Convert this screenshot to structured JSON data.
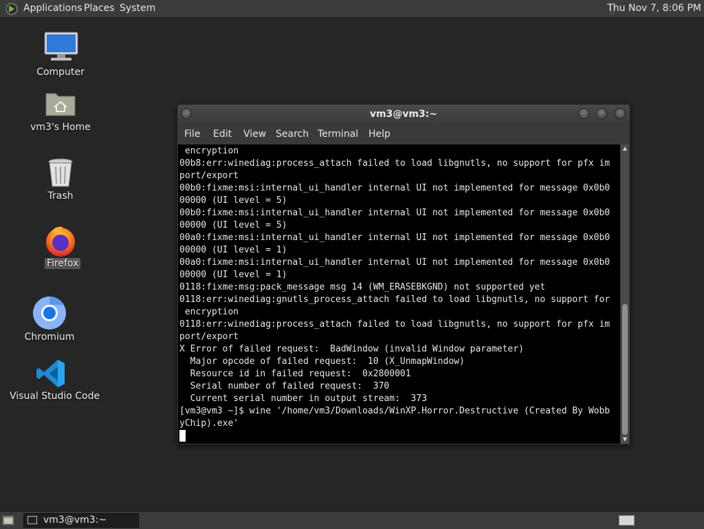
{
  "top_panel": {
    "menus": [
      "Applications",
      "Places",
      "System"
    ],
    "clock": "Thu Nov 7,  8:06 PM"
  },
  "desktop_icons": [
    {
      "label": "Computer"
    },
    {
      "label": "vm3's Home"
    },
    {
      "label": "Trash"
    },
    {
      "label": "Firefox"
    },
    {
      "label": "Chromium"
    },
    {
      "label": "Visual Studio Code"
    }
  ],
  "terminal": {
    "title": "vm3@vm3:~",
    "menus": [
      "File",
      "Edit",
      "View",
      "Search",
      "Terminal",
      "Help"
    ],
    "output": " encryption\n00b8:err:winediag:process_attach failed to load libgnutls, no support for pfx im\nport/export\n00b0:fixme:msi:internal_ui_handler internal UI not implemented for message 0x0b0\n00000 (UI level = 5)\n00b0:fixme:msi:internal_ui_handler internal UI not implemented for message 0x0b0\n00000 (UI level = 5)\n00a0:fixme:msi:internal_ui_handler internal UI not implemented for message 0x0b0\n00000 (UI level = 1)\n00a0:fixme:msi:internal_ui_handler internal UI not implemented for message 0x0b0\n00000 (UI level = 1)\n0118:fixme:msg:pack_message msg 14 (WM_ERASEBKGND) not supported yet\n0118:err:winediag:gnutls_process_attach failed to load libgnutls, no support for\n encryption\n0118:err:winediag:process_attach failed to load libgnutls, no support for pfx im\nport/export\nX Error of failed request:  BadWindow (invalid Window parameter)\n  Major opcode of failed request:  10 (X_UnmapWindow)\n  Resource id in failed request:  0x2800001\n  Serial number of failed request:  370\n  Current serial number in output stream:  373\n[vm3@vm3 ~]$ wine '/home/vm3/Downloads/WinXP.Horror.Destructive (Created By Wobb\nyChip).exe'"
  },
  "taskbar": {
    "window_button": "vm3@vm3:~"
  }
}
